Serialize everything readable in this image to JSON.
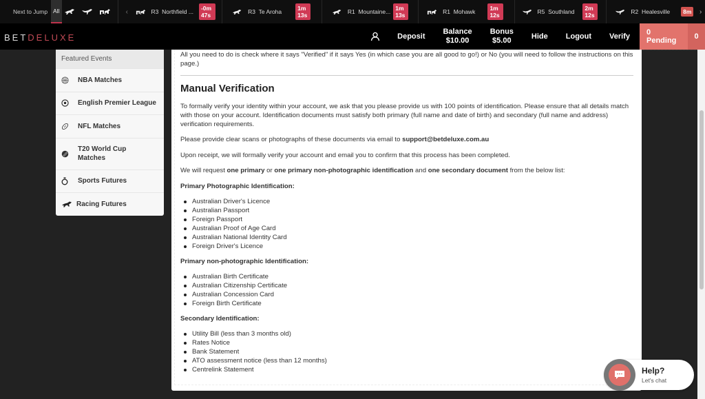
{
  "next_to_jump": {
    "label": "Next to Jump",
    "tab_all": "All",
    "filters": [
      "thoroughbred-icon",
      "greyhound-icon",
      "harness-icon"
    ],
    "prev_arrow": "‹",
    "next_arrow": "›",
    "races": [
      {
        "type": "harness",
        "race": "R3",
        "venue": "Northfield ...",
        "time": "-0m 47s"
      },
      {
        "type": "thoroughbred",
        "race": "R3",
        "venue": "Te Aroha",
        "time": "1m 13s"
      },
      {
        "type": "thoroughbred",
        "race": "R1",
        "venue": "Mountaine...",
        "time": "1m 13s"
      },
      {
        "type": "harness",
        "race": "R1",
        "venue": "Mohawk",
        "time": "1m 12s"
      },
      {
        "type": "greyhound",
        "race": "R5",
        "venue": "Southland",
        "time": "2m 12s"
      },
      {
        "type": "greyhound",
        "race": "R2",
        "venue": "Healesville",
        "time": "8m"
      }
    ],
    "badge_color": "#d03a55"
  },
  "header": {
    "logo_part1": "BET",
    "logo_part2": "DELUXE",
    "deposit": "Deposit",
    "balance_label": "Balance",
    "balance_value": "$10.00",
    "bonus_label": "Bonus",
    "bonus_value": "$5.00",
    "hide": "Hide",
    "logout": "Logout",
    "verify": "Verify",
    "pending": "0 Pending",
    "pending_count": "0",
    "accent_color": "#e2736c"
  },
  "sidebar": {
    "heading": "Featured Events",
    "items": [
      {
        "icon": "basketball-icon",
        "label": "NBA Matches"
      },
      {
        "icon": "soccer-ball-icon",
        "label": "English Premier League"
      },
      {
        "icon": "football-icon",
        "label": "NFL Matches"
      },
      {
        "icon": "cricket-ball-icon",
        "label": "T20 World Cup Matches"
      },
      {
        "icon": "stopwatch-icon",
        "label": "Sports Futures"
      },
      {
        "icon": "racehorse-icon",
        "label": "Racing Futures"
      }
    ]
  },
  "content": {
    "intro": "All you need to do is check where it says \"Verified\" if it says Yes (in which case you are all good to go!) or No (you will need to follow the instructions on this page.)",
    "title": "Manual Verification",
    "para1": "To formally verify your identity within your account, we ask that you please provide us with 100 points of identification. Please ensure that all details match with those on your account. Identification documents must satisfy both primary (full name and date of birth) and secondary (full name and address) verification requirements.",
    "para2_prefix": "Please provide clear scans or photographs of these documents via email to ",
    "email": "support@betdeluxe.com.au",
    "para3": "Upon receipt, we will formally verify your account and email you to confirm that this process has been completed.",
    "para4": {
      "t1": "We will request ",
      "b1": "one primary",
      "t2": " or ",
      "b2": "one primary non-photographic identification",
      "t3": " and ",
      "b3": "one secondary document",
      "t4": " from the below list:"
    },
    "primary_photo_heading": "Primary Photographic Identification:",
    "primary_photo": [
      "Australian Driver's Licence",
      "Australian Passport",
      "Foreign Passport",
      "Australian Proof of Age Card",
      "Australian National Identity Card",
      "Foreign Driver's Licence"
    ],
    "primary_nonphoto_heading": "Primary non-photographic Identification:",
    "primary_nonphoto": [
      "Australian Birth Certificate",
      "Australian Citizenship Certificate",
      "Australian Concession Card",
      "Foreign Birth Certificate"
    ],
    "secondary_heading": "Secondary Identification:",
    "secondary": [
      "Utility Bill (less than 3 months old)",
      "Rates Notice",
      "Bank Statement",
      "ATO assessment notice (less than 12 months)",
      "Centrelink Statement"
    ]
  },
  "help": {
    "title": "Help?",
    "subtitle": "Let's chat"
  }
}
